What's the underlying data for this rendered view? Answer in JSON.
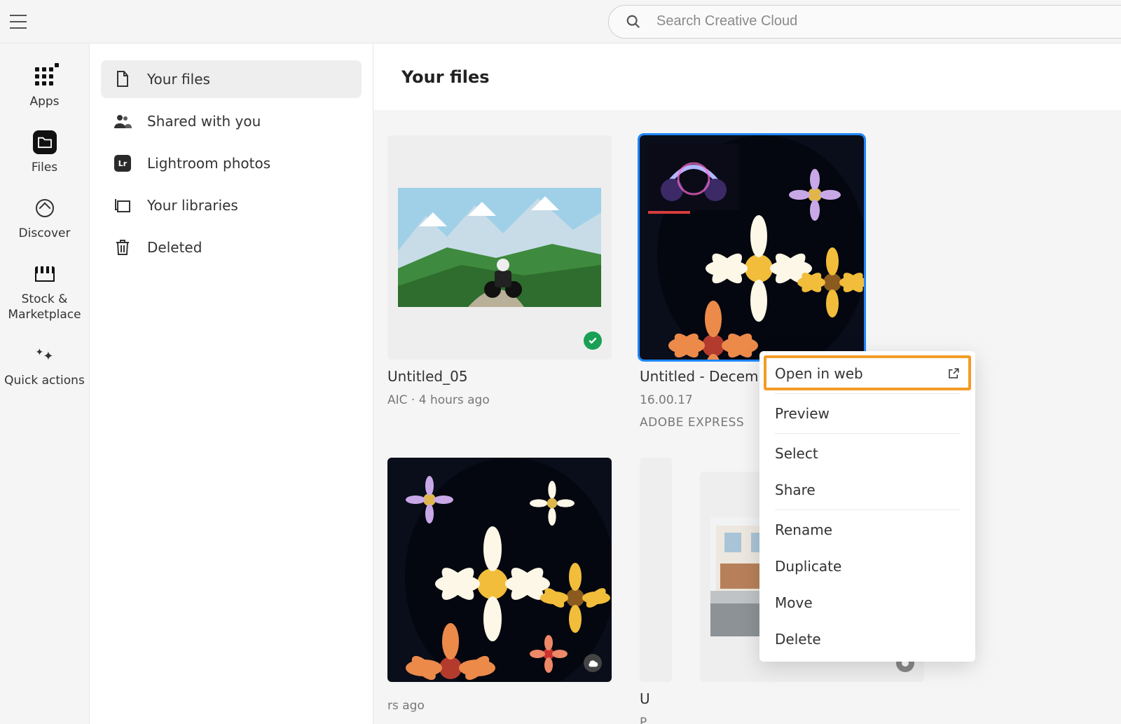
{
  "search": {
    "placeholder": "Search Creative Cloud"
  },
  "rail": {
    "apps": "Apps",
    "files": "Files",
    "discover": "Discover",
    "stock": "Stock & Marketplace",
    "quick": "Quick actions"
  },
  "sidebar": {
    "your_files": "Your files",
    "shared": "Shared with you",
    "lightroom": "Lightroom photos",
    "libraries": "Your libraries",
    "deleted": "Deleted"
  },
  "page": {
    "title": "Your files"
  },
  "cards": [
    {
      "title": "Untitled_05",
      "meta": "AIC · 4 hours ago",
      "app": ""
    },
    {
      "title": "Untitled - Decemb",
      "meta": "16.00.17",
      "app": "ADOBE EXPRESS"
    },
    {
      "title": "",
      "meta": "rs ago",
      "app": ""
    },
    {
      "title": "U",
      "meta": "P",
      "app": ""
    }
  ],
  "context_menu": {
    "open_web": "Open in web",
    "preview": "Preview",
    "select": "Select",
    "share": "Share",
    "rename": "Rename",
    "duplicate": "Duplicate",
    "move": "Move",
    "delete": "Delete"
  }
}
